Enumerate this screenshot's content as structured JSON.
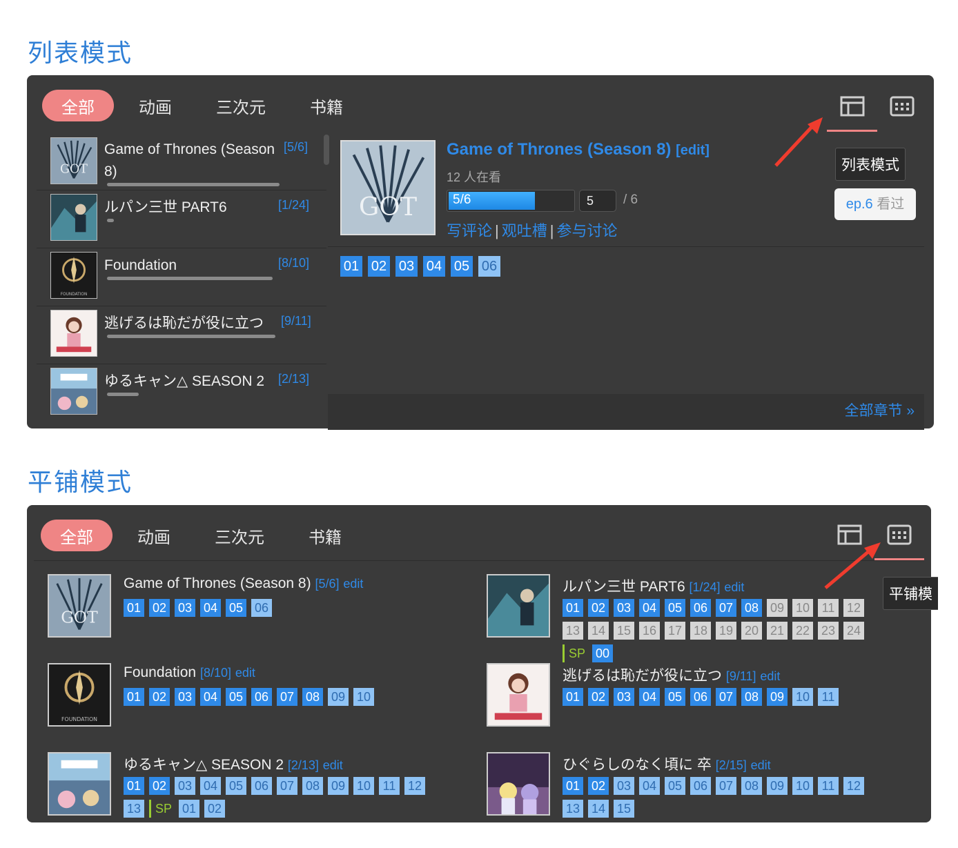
{
  "sections": {
    "list_title": "列表模式",
    "grid_title": "平铺模式"
  },
  "tabs": [
    "全部",
    "动画",
    "三次元",
    "书籍"
  ],
  "tooltips": {
    "list_mode": "列表模式",
    "grid_mode": "平铺模"
  },
  "list_mode": {
    "items": [
      {
        "title": "Game of Thrones (Season 8)",
        "count": "[5/6]",
        "progress": 0.83
      },
      {
        "title": "ルパン三世 PART6",
        "count": "[1/24]",
        "progress": 0.04
      },
      {
        "title": "Foundation",
        "count": "[8/10]",
        "progress": 0.8
      },
      {
        "title": "逃げるは恥だが役に立つ",
        "count": "[9/11]",
        "progress": 0.82
      },
      {
        "title": "ゆるキャン△ SEASON 2",
        "count": "[2/13]",
        "progress": 0.15
      }
    ],
    "detail": {
      "title": "Game of Thrones (Season 8)",
      "edit": "[edit]",
      "watching": "12 人在看",
      "progress_text": "5/6",
      "progress": 0.83,
      "ep_input": "5",
      "ep_total": "/ 6",
      "links": [
        "写评论",
        "观吐槽",
        "参与讨论"
      ],
      "ep_label": "ep.6",
      "seen_label": "看过",
      "episodes": [
        "01",
        "02",
        "03",
        "04",
        "05",
        "06"
      ],
      "all_chapters": "全部章节 »"
    }
  },
  "grid_mode": {
    "cards": [
      {
        "title": "Game of Thrones (Season 8)",
        "count": "[5/6]",
        "edit": "edit",
        "watched": 5,
        "episodes": [
          "01",
          "02",
          "03",
          "04",
          "05",
          "06"
        ],
        "aired": 6,
        "sp": []
      },
      {
        "title": "ルパン三世 PART6",
        "count": "[1/24]",
        "edit": "edit",
        "watched": 8,
        "episodes": [
          "01",
          "02",
          "03",
          "04",
          "05",
          "06",
          "07",
          "08",
          "09",
          "10",
          "11",
          "12",
          "13",
          "14",
          "15",
          "16",
          "17",
          "18",
          "19",
          "20",
          "21",
          "22",
          "23",
          "24"
        ],
        "aired": 8,
        "sp_label": "SP",
        "sp": [
          "00"
        ]
      },
      {
        "title": "Foundation",
        "count": "[8/10]",
        "edit": "edit",
        "watched": 8,
        "episodes": [
          "01",
          "02",
          "03",
          "04",
          "05",
          "06",
          "07",
          "08",
          "09",
          "10"
        ],
        "aired": 10,
        "sp": []
      },
      {
        "title": "逃げるは恥だが役に立つ",
        "count": "[9/11]",
        "edit": "edit",
        "watched": 9,
        "episodes": [
          "01",
          "02",
          "03",
          "04",
          "05",
          "06",
          "07",
          "08",
          "09",
          "10",
          "11"
        ],
        "aired": 11,
        "sp": []
      },
      {
        "title": "ゆるキャン△ SEASON 2",
        "count": "[2/13]",
        "edit": "edit",
        "watched": 2,
        "episodes": [
          "01",
          "02",
          "03",
          "04",
          "05",
          "06",
          "07",
          "08",
          "09",
          "10",
          "11",
          "12",
          "13"
        ],
        "aired": 13,
        "sp_label": "SP",
        "sp": [
          "01",
          "02"
        ],
        "sp_aired": 2
      },
      {
        "title": "ひぐらしのなく頃に 卒",
        "count": "[2/15]",
        "edit": "edit",
        "watched": 2,
        "episodes": [
          "01",
          "02",
          "03",
          "04",
          "05",
          "06",
          "07",
          "08",
          "09",
          "10",
          "11",
          "12",
          "13",
          "14",
          "15"
        ],
        "aired": 15,
        "sp": []
      }
    ]
  },
  "colors": {
    "accent": "#2f8ae8",
    "tab_active": "#ef8585",
    "panel": "#3a3a3a",
    "sp": "#9acd32"
  },
  "icons": {
    "list_mode": "list-layout-icon",
    "grid_mode": "grid-layout-icon",
    "arrow": "red-arrow-icon"
  }
}
